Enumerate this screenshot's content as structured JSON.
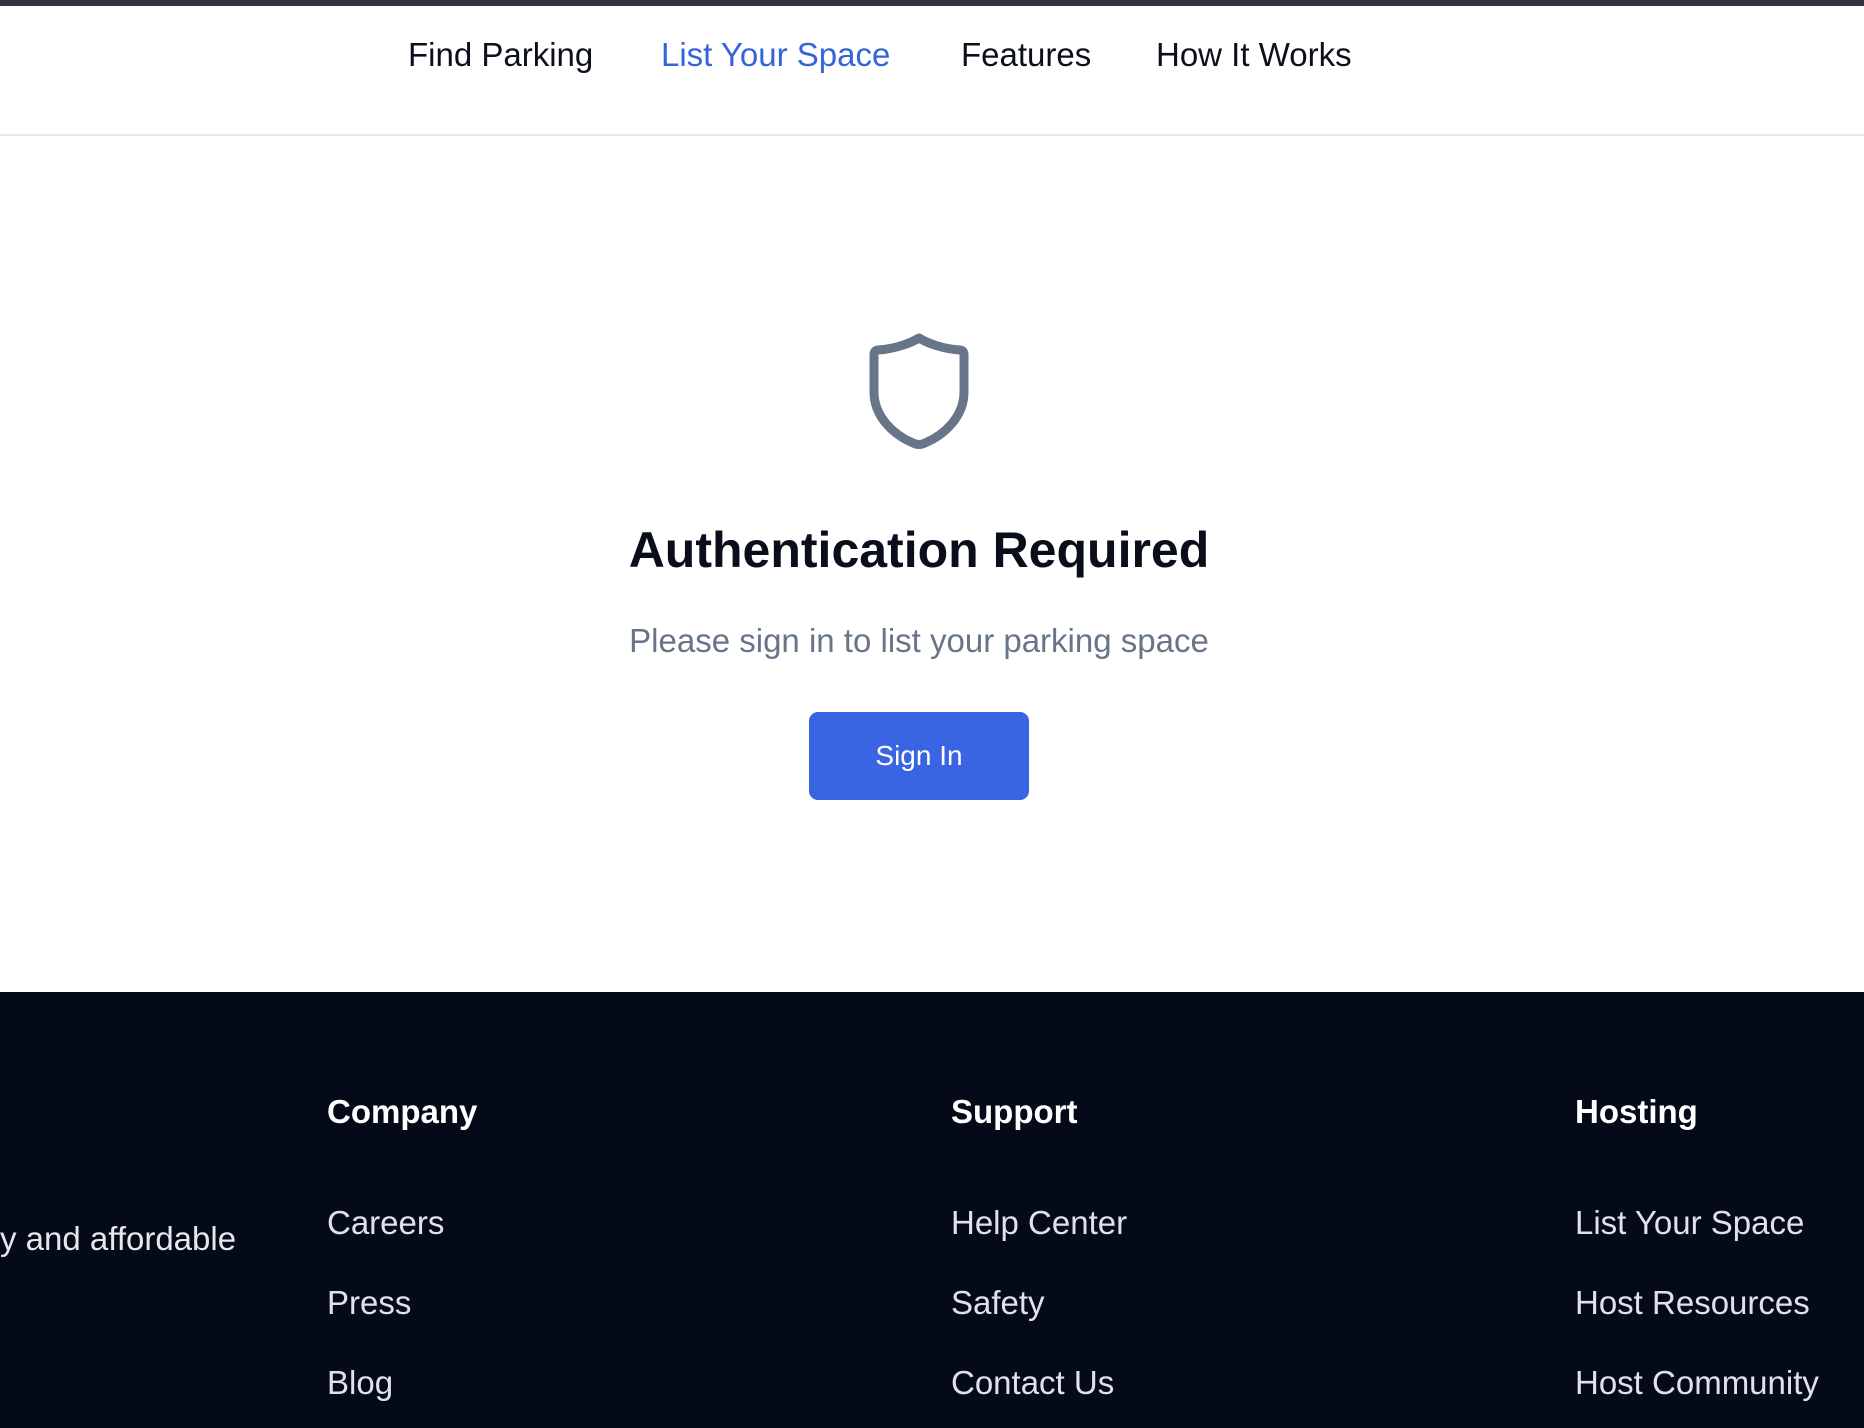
{
  "nav": {
    "items": [
      {
        "label": "Find Parking",
        "active": false
      },
      {
        "label": "List Your Space",
        "active": true
      },
      {
        "label": "Features",
        "active": false
      },
      {
        "label": "How It Works",
        "active": false
      }
    ],
    "active_color": "#3464d8"
  },
  "auth": {
    "icon": "shield-icon",
    "title": "Authentication Required",
    "subtitle": "Please sign in to list your parking space",
    "button_label": "Sign In"
  },
  "footer": {
    "tagline": "y and affordable",
    "columns": [
      {
        "heading": "Company",
        "links": [
          "Careers",
          "Press",
          "Blog"
        ]
      },
      {
        "heading": "Support",
        "links": [
          "Help Center",
          "Safety",
          "Contact Us"
        ]
      },
      {
        "heading": "Hosting",
        "links": [
          "List Your Space",
          "Host Resources",
          "Host Community"
        ]
      }
    ]
  },
  "colors": {
    "primary": "#3965e3",
    "footer_bg": "#040a18",
    "muted_text": "#687588"
  }
}
